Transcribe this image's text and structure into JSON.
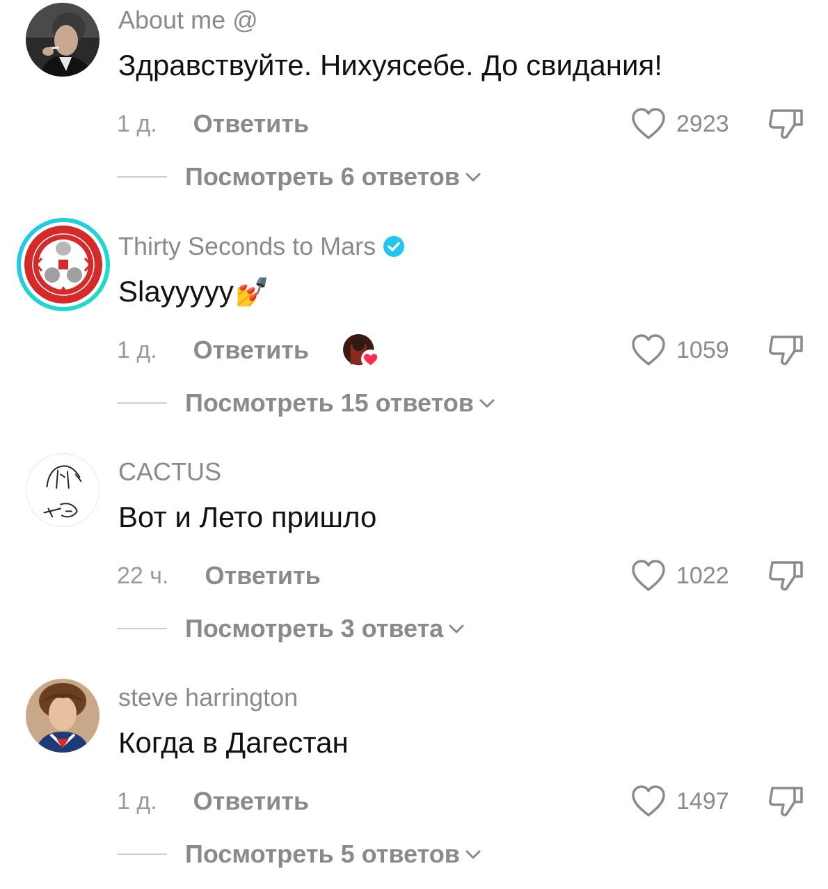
{
  "comments": [
    {
      "username": "About me @",
      "text": "Здравствуйте. Нихуясебе. До свидания!",
      "time": "1 д.",
      "reply_label": "Ответить",
      "likes": "2923",
      "view_replies": "Посмотреть 6 ответов",
      "avatar_icon": "man-smoking-avatar"
    },
    {
      "username": "Thirty Seconds to Mars",
      "verified": true,
      "text": "Slayyyyy",
      "emoji": "💅",
      "time": "1 д.",
      "reply_label": "Ответить",
      "likes": "1059",
      "view_replies": "Посмотреть 15 ответов",
      "avatar_icon": "band-logo-avatar"
    },
    {
      "username": "CACTUS",
      "text": "Вот и Лето пришло",
      "time": "22 ч.",
      "reply_label": "Ответить",
      "likes": "1022",
      "view_replies": "Посмотреть 3 ответа",
      "avatar_icon": "sketch-avatar"
    },
    {
      "username": "steve harrington",
      "text": "Когда в Дагестан",
      "time": "1 д.",
      "reply_label": "Ответить",
      "likes": "1497",
      "view_replies": "Посмотреть 5 ответов",
      "avatar_icon": "young-man-avatar"
    }
  ],
  "colors": {
    "muted": "#8a8a8a",
    "text": "#111111",
    "verified": "#20c5f0",
    "heart_badge": "#fe2c55",
    "band_red": "#d42a2a"
  }
}
